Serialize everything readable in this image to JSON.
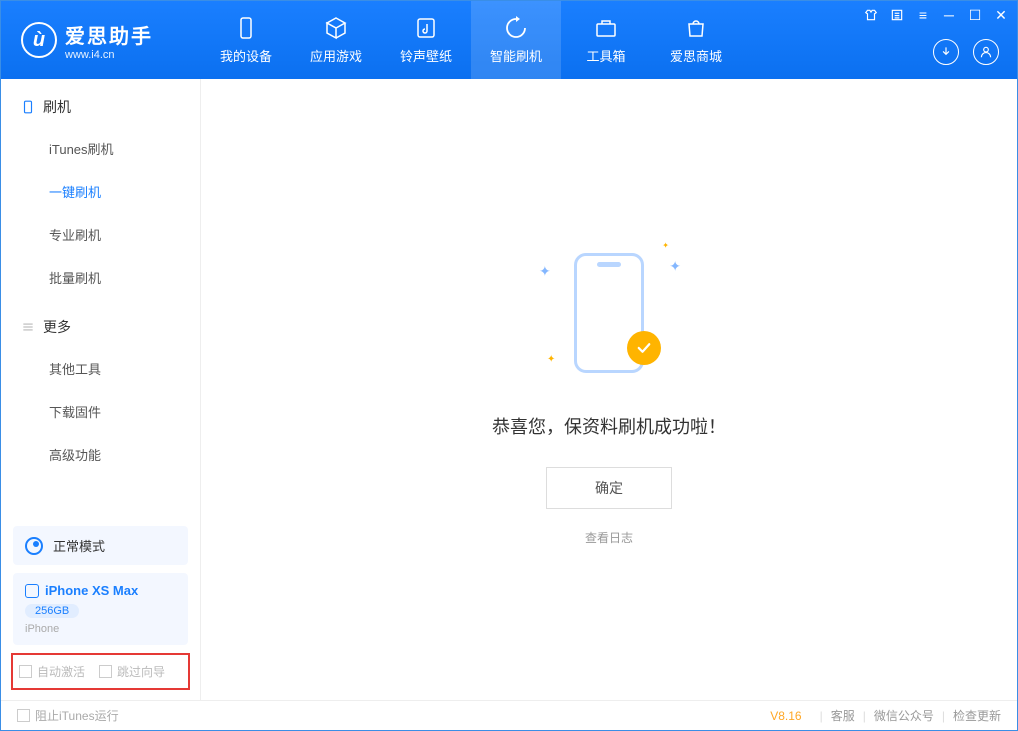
{
  "app": {
    "title": "爱思助手",
    "subtitle": "www.i4.cn"
  },
  "nav": {
    "tabs": [
      {
        "label": "我的设备",
        "icon": "device"
      },
      {
        "label": "应用游戏",
        "icon": "cube"
      },
      {
        "label": "铃声壁纸",
        "icon": "music"
      },
      {
        "label": "智能刷机",
        "icon": "refresh",
        "active": true
      },
      {
        "label": "工具箱",
        "icon": "toolbox"
      },
      {
        "label": "爱思商城",
        "icon": "shop"
      }
    ]
  },
  "sidebar": {
    "section1": {
      "title": "刷机",
      "items": [
        {
          "label": "iTunes刷机"
        },
        {
          "label": "一键刷机",
          "active": true
        },
        {
          "label": "专业刷机"
        },
        {
          "label": "批量刷机"
        }
      ]
    },
    "section2": {
      "title": "更多",
      "items": [
        {
          "label": "其他工具"
        },
        {
          "label": "下载固件"
        },
        {
          "label": "高级功能"
        }
      ]
    },
    "mode": {
      "label": "正常模式"
    },
    "device": {
      "name": "iPhone XS Max",
      "capacity": "256GB",
      "type": "iPhone"
    },
    "checkboxes": {
      "auto_activate": "自动激活",
      "skip_guide": "跳过向导"
    }
  },
  "main": {
    "success_message": "恭喜您，保资料刷机成功啦！",
    "ok_button": "确定",
    "view_log": "查看日志"
  },
  "footer": {
    "block_itunes": "阻止iTunes运行",
    "version": "V8.16",
    "links": {
      "support": "客服",
      "wechat": "微信公众号",
      "update": "检查更新"
    }
  }
}
